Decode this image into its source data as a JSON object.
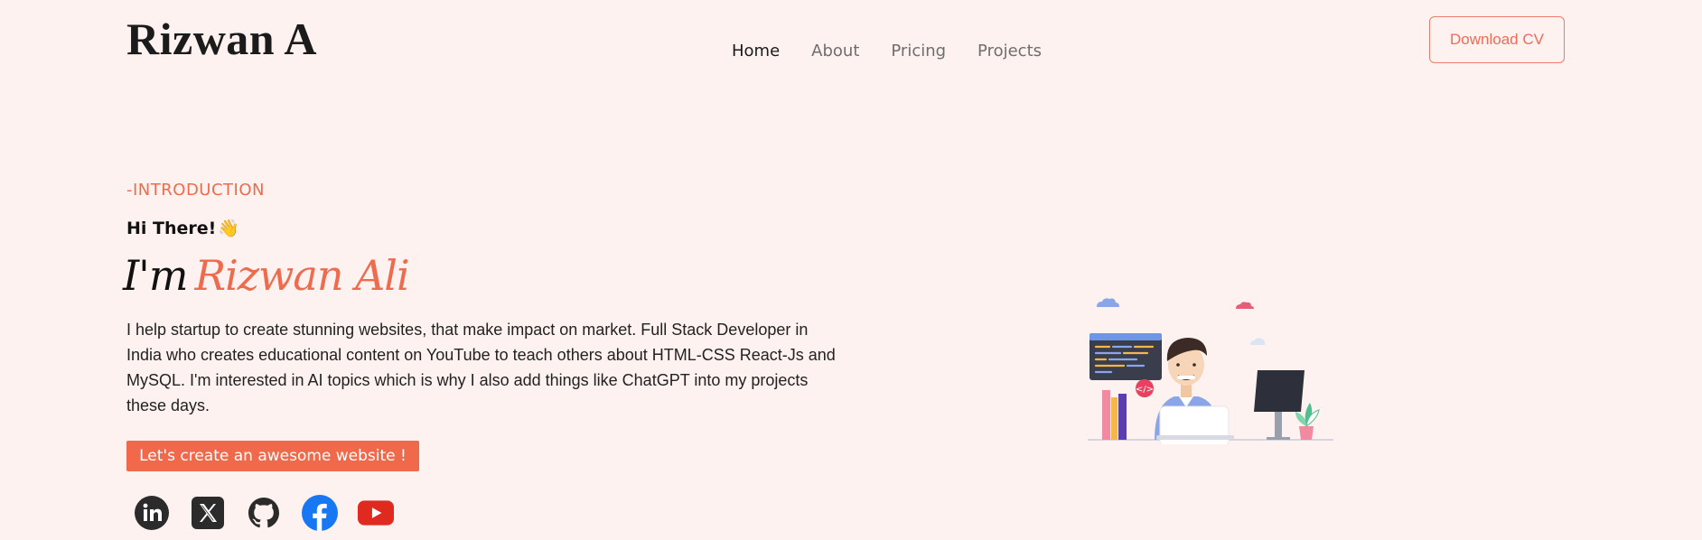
{
  "header": {
    "logo": "Rizwan A",
    "nav": [
      {
        "label": "Home",
        "active": true
      },
      {
        "label": "About",
        "active": false
      },
      {
        "label": "Pricing",
        "active": false
      },
      {
        "label": "Projects",
        "active": false
      }
    ],
    "cv_button": "Download CV"
  },
  "hero": {
    "eyebrow": "-INTRODUCTION",
    "greeting": "Hi There!",
    "greeting_emoji": "👋",
    "im_prefix": "I'm",
    "name": "Rizwan Ali",
    "description": "I help startup to create stunning websites, that make impact on market. Full Stack Developer in India who creates educational content on YouTube to teach others about HTML-CSS React-Js and MySQL. I'm interested in AI topics which is why I also add things like ChatGPT into my projects these days.",
    "cta": "Let's create an awesome website !"
  },
  "socials": [
    {
      "icon": "linkedin-icon"
    },
    {
      "icon": "x-twitter-icon"
    },
    {
      "icon": "github-icon"
    },
    {
      "icon": "facebook-icon"
    },
    {
      "icon": "youtube-icon"
    }
  ],
  "colors": {
    "background": "#fdf2ef",
    "accent": "#ef6b4d",
    "text": "#1b1b1b"
  }
}
